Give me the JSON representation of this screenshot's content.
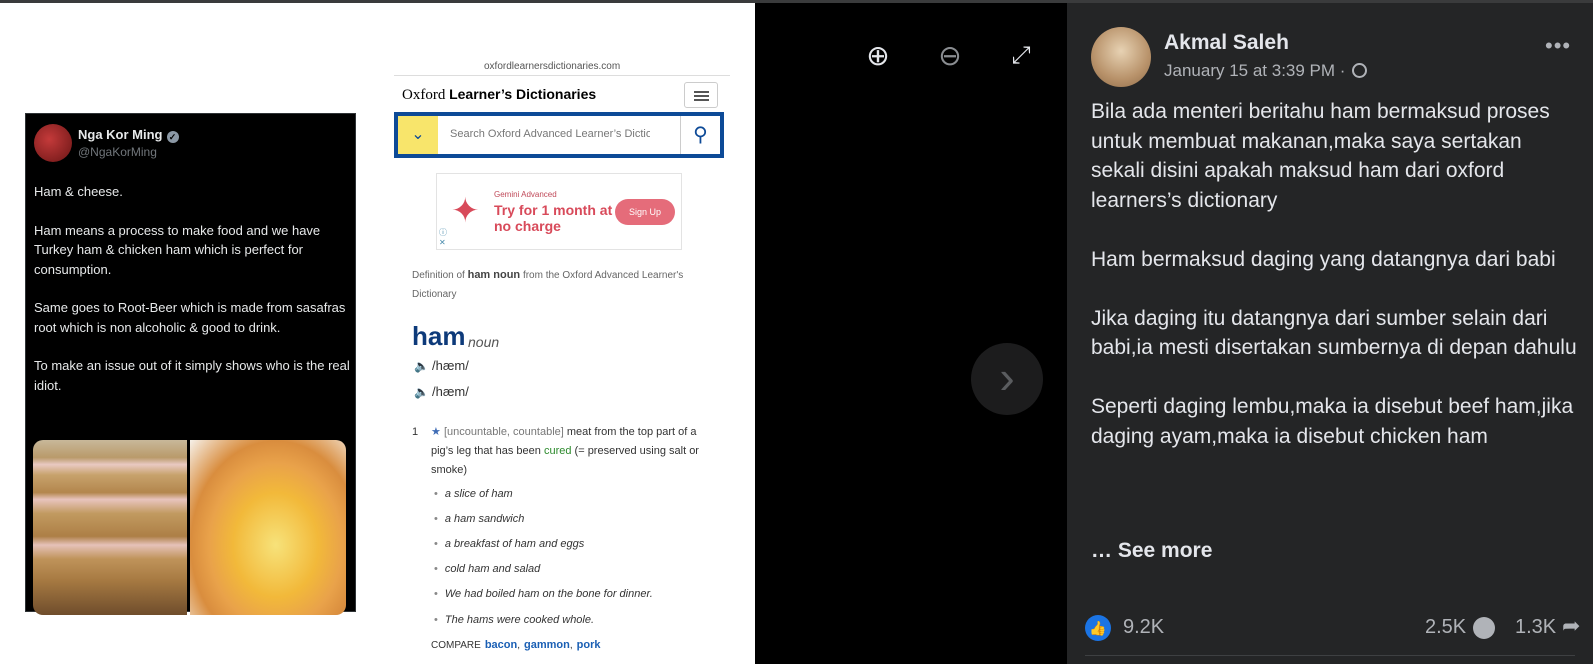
{
  "tweet": {
    "name": "Nga Kor Ming",
    "handle": "@NgaKorMing",
    "paragraphs": [
      "Ham & cheese.",
      "Ham means a process to make food and we have Turkey ham & chicken ham which is perfect for consumption.",
      "Same goes to Root-Beer which is made from sasafras root which is non alcoholic & good to drink.",
      "To make an issue out of it simply shows who is the real idiot."
    ]
  },
  "oxford": {
    "url": "oxfordlearnersdictionaries.com",
    "brand_prefix": "Oxford",
    "brand_name": "Learner’s Dictionaries",
    "search_placeholder": "Search Oxford Advanced Learner’s Dictionary",
    "ad": {
      "sponsor": "Gemini Advanced",
      "headline": "Try for 1 month at no charge",
      "cta": "Sign Up"
    },
    "def_source_pre": "Definition of",
    "def_source_word": "ham noun",
    "def_source_post": "from the Oxford Advanced Learner's Dictionary",
    "headword": "ham",
    "part_of_speech": "noun",
    "pronunciations": [
      "/hæm/",
      "/hæm/"
    ],
    "sense_number": "1",
    "grammar": "[uncountable, countable]",
    "definition_pre": "meat from the top part of a pig’s leg that has been",
    "definition_link": "cured",
    "definition_post": "(= preserved using salt or smoke)",
    "examples": [
      "a slice of ham",
      "a ham sandwich",
      "a breakfast of ham and eggs",
      "cold ham and salad",
      "We had boiled ham on the bone for dinner.",
      "The hams were cooked whole."
    ],
    "compare_label": "COMPARE",
    "compare_links": [
      "bacon",
      "gammon",
      "pork"
    ]
  },
  "post": {
    "author": "Akmal Saleh",
    "date": "January 15 at 3:39 PM ·",
    "paragraphs": [
      "Bila ada menteri beritahu ham bermaksud proses untuk membuat makanan,maka saya sertakan sekali disini apakah maksud ham dari oxford learners’s dictionary",
      "Ham bermaksud daging yang datangnya dari babi",
      "Jika daging itu datangnya dari sumber selain dari babi,ia mesti disertakan sumbernya di depan dahulu",
      "Seperti daging lembu,maka ia disebut beef ham,jika daging ayam,maka ia disebut chicken ham"
    ],
    "see_more": "… See more",
    "likes": "9.2K",
    "comments": "2.5K",
    "shares": "1.3K"
  },
  "colors": {
    "oxford_blue": "#0d4a97",
    "facebook_blue": "#1b74e4",
    "panel_bg": "#242526"
  }
}
